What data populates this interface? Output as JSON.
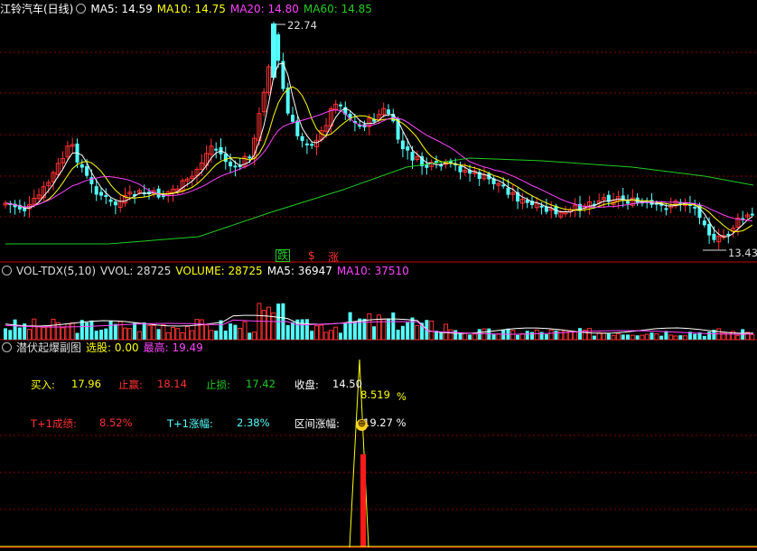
{
  "main": {
    "title": "江铃汽车(日线)",
    "ma": [
      {
        "label": "MA5: 14.59",
        "color": "#ffffff"
      },
      {
        "label": "MA10: 14.75",
        "color": "#ffff00"
      },
      {
        "label": "MA20: 14.80",
        "color": "#ff44ff"
      },
      {
        "label": "MA60: 14.85",
        "color": "#22cc22"
      }
    ],
    "high_label": "22.74",
    "low_label": "13.43",
    "signal_die": "跌",
    "signal_s": "$",
    "signal_zhang": "涨"
  },
  "vol": {
    "title": "VOL-TDX(5,10)",
    "vvol": "VVOL: 28725",
    "volume": "VOLUME: 28725",
    "ma5": "MA5: 36947",
    "ma10": "MA10: 37510"
  },
  "sub": {
    "title": "潜伏起爆副图",
    "pick": "选股: 0.00",
    "high": "最高: 19.49",
    "buy_label": "买入:",
    "buy_val": "17.96",
    "tp_label": "止赢:",
    "tp_val": "18.14",
    "sl_label": "止损:",
    "sl_val": "17.42",
    "close_label": "收盘:",
    "close_val": "14.50",
    "t1_label": "T+1成绩:",
    "t1_val": "8.52%",
    "t1r_label": "T+1涨幅:",
    "t1r_val": "2.38%",
    "range_label": "区间涨幅:",
    "range_val": "19.27 %",
    "peak_val": "8.519",
    "peak_unit": "%"
  },
  "colors": {
    "up": "#ff3232",
    "down": "#54ffff",
    "grid": "#8b0000",
    "ma5": "#ffffff",
    "ma10": "#ffff00",
    "ma20": "#ff44ff",
    "ma60": "#22cc22"
  },
  "chart_data": {
    "type": "candlestick",
    "title": "江铃汽车(日线)",
    "price_high_marker": 22.74,
    "price_low_marker": 13.43,
    "last_ma": {
      "MA5": 14.59,
      "MA10": 14.75,
      "MA20": 14.8,
      "MA60": 14.85
    },
    "volume_last": {
      "VVOL": 28725,
      "VOLUME": 28725,
      "MA5": 36947,
      "MA10": 37510
    },
    "indicator": {
      "name": "潜伏起爆副图",
      "选股": 0.0,
      "最高": 19.49,
      "买入": 17.96,
      "止赢": 18.14,
      "止损": 17.42,
      "收盘": 14.5,
      "T+1成绩": "8.52%",
      "T+1涨幅": "2.38%",
      "区间涨幅": "19.27 %",
      "peak": 8.519
    }
  }
}
